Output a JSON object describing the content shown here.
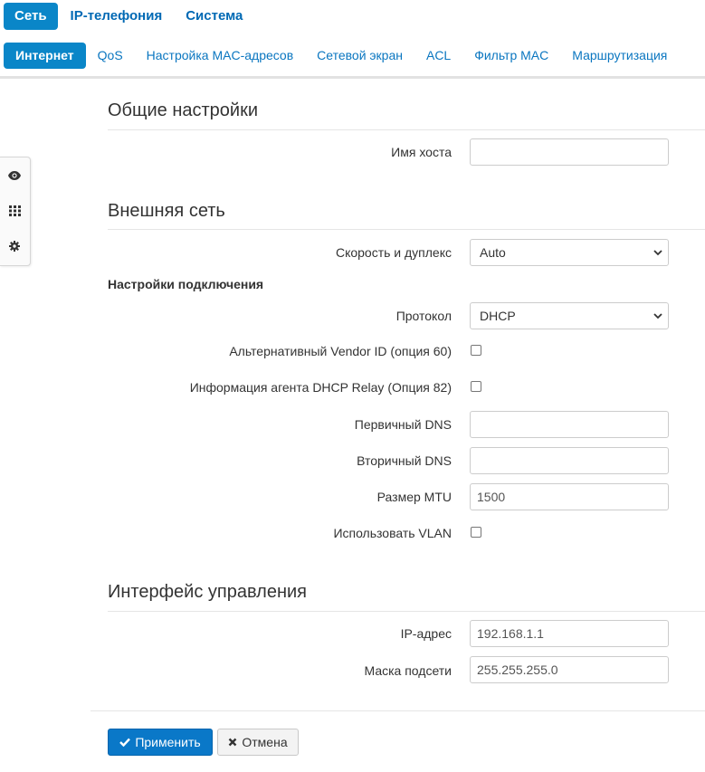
{
  "top_nav": {
    "tabs": [
      {
        "label": "Сеть",
        "active": true
      },
      {
        "label": "IP-телефония",
        "active": false
      },
      {
        "label": "Система",
        "active": false
      }
    ]
  },
  "sub_nav": {
    "tabs": [
      {
        "label": "Интернет",
        "active": true
      },
      {
        "label": "QoS",
        "active": false
      },
      {
        "label": "Настройка MAC-адресов",
        "active": false
      },
      {
        "label": "Сетевой экран",
        "active": false
      },
      {
        "label": "ACL",
        "active": false
      },
      {
        "label": "Фильтр MAC",
        "active": false
      },
      {
        "label": "Маршрутизация",
        "active": false
      }
    ]
  },
  "side_toolbar": {
    "icons": [
      "eye-icon",
      "grid-icon",
      "gear-icon"
    ]
  },
  "general": {
    "title": "Общие настройки",
    "hostname_label": "Имя хоста",
    "hostname_value": ""
  },
  "wan": {
    "title": "Внешняя сеть",
    "speed_label": "Скорость и дуплекс",
    "speed_value": "Auto",
    "connection_heading": "Настройки подключения",
    "protocol_label": "Протокол",
    "protocol_value": "DHCP",
    "vendor_id_label": "Альтернативный Vendor ID (опция 60)",
    "vendor_id_checked": false,
    "relay_label": "Информация агента DHCP Relay (Опция 82)",
    "relay_checked": false,
    "primary_dns_label": "Первичный DNS",
    "primary_dns_value": "",
    "secondary_dns_label": "Вторичный DNS",
    "secondary_dns_value": "",
    "mtu_label": "Размер MTU",
    "mtu_value": "1500",
    "vlan_label": "Использовать VLAN",
    "vlan_checked": false
  },
  "mgmt": {
    "title": "Интерфейс управления",
    "ip_label": "IP-адрес",
    "ip_value": "192.168.1.1",
    "mask_label": "Маска подсети",
    "mask_value": "255.255.255.0"
  },
  "actions": {
    "apply_label": "Применить",
    "cancel_label": "Отмена"
  },
  "colors": {
    "accent": "#0a86c8",
    "link": "#0a76c0",
    "primary_button": "#0a78c8"
  }
}
